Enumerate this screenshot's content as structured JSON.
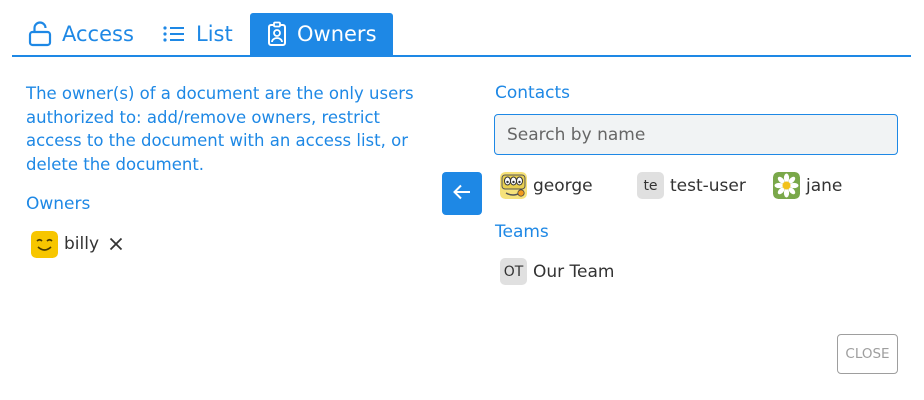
{
  "tabs": [
    {
      "label": "Access",
      "icon": "unlock-icon",
      "active": false
    },
    {
      "label": "List",
      "icon": "list-icon",
      "active": false
    },
    {
      "label": "Owners",
      "icon": "badge-icon",
      "active": true
    }
  ],
  "description": "The owner(s) of a document are the only users authorized to: add/remove owners, restrict access to the document with an access list, or delete the document.",
  "owners": {
    "label": "Owners",
    "items": [
      {
        "name": "billy",
        "avatar": "smiley-avatar"
      }
    ]
  },
  "contacts": {
    "label": "Contacts",
    "search_placeholder": "Search by name",
    "items": [
      {
        "name": "george",
        "avatar": "monster-avatar"
      },
      {
        "name": "test-user",
        "avatar_initials": "te"
      },
      {
        "name": "jane",
        "avatar": "daisy-avatar"
      }
    ]
  },
  "teams": {
    "label": "Teams",
    "items": [
      {
        "name": "Our Team",
        "avatar_initials": "OT"
      }
    ]
  },
  "close_label": "CLOSE",
  "colors": {
    "accent": "#1e88e5",
    "text": "#333333",
    "muted": "#9e9e9e",
    "input_bg": "#f1f3f4",
    "chip_bg": "#e0e0e0"
  }
}
